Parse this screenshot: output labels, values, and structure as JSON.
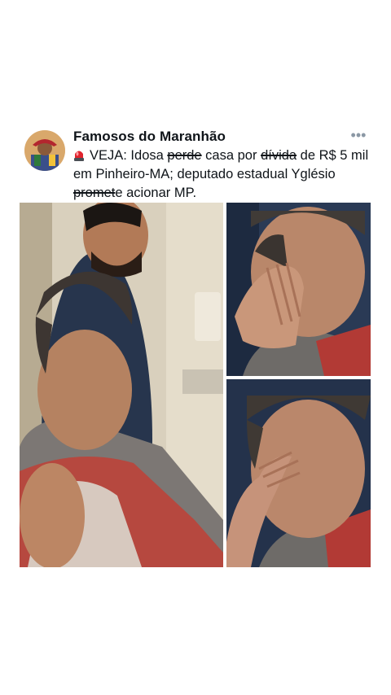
{
  "post": {
    "author_name": "Famosos do Maranhão",
    "more_icon": "•••",
    "text_parts": {
      "emoji": "siren-emoji",
      "p1": "VEJA: Idosa ",
      "strike1": "perde",
      "p2": " casa por ",
      "strike2": "dívida",
      "p3": " de R$ 5 mil em Pinheiro-MA; deputado estadual Yglésio ",
      "strike3": "promet",
      "p4": "e acionar MP."
    },
    "images": [
      {
        "name": "elderly-woman-seated-with-man-behind"
      },
      {
        "name": "elderly-woman-crying-hand-on-face"
      },
      {
        "name": "elderly-woman-crying-hand-on-forehead"
      }
    ]
  },
  "colors": {
    "text": "#0f1419",
    "secondary": "#8b98a5",
    "siren_red": "#e0242e"
  }
}
